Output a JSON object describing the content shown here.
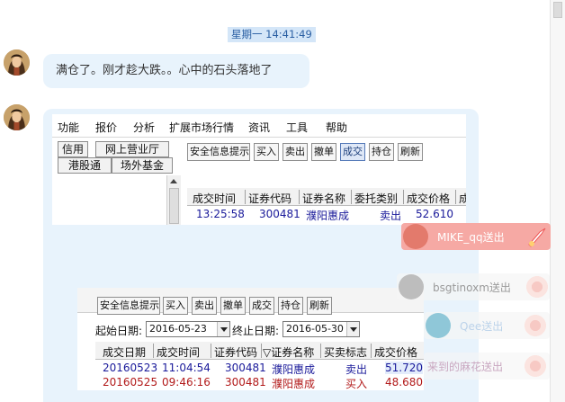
{
  "timestamp": "星期一 14:41:49",
  "messages": {
    "first_text": "满仓了。刚才趁大跌。。心中的石头落地了"
  },
  "shot1": {
    "menu": [
      "功能",
      "报价",
      "分析",
      "扩展市场行情",
      "资讯",
      "工具",
      "帮助"
    ],
    "tabs": [
      "信用",
      "网上营业厅",
      "港股通",
      "场外基金"
    ],
    "toolbar": [
      "安全信息提示",
      "买入",
      "卖出",
      "撤单",
      "成交",
      "持仓",
      "刷新"
    ],
    "active_toolbar": "成交",
    "columns": [
      "成交时间",
      "证券代码",
      "证券名称",
      "委托类别",
      "成交价格",
      "成"
    ],
    "rows": [
      {
        "time": "13:25:58",
        "code": "300481",
        "name": "濮阳惠成",
        "type": "卖出",
        "price": "52.610"
      }
    ]
  },
  "shot2": {
    "toolbar": [
      "安全信息提示",
      "买入",
      "卖出",
      "撤单",
      "成交",
      "持仓",
      "刷新"
    ],
    "start_label": "起始日期:",
    "start_date": "2016-05-23",
    "end_label": "终止日期:",
    "end_date": "2016-05-30",
    "columns": [
      "成交日期",
      "成交时间",
      "证券代码",
      "▽证券名称",
      "买卖标志",
      "成交价格"
    ],
    "rows": [
      {
        "date": "20160523",
        "time": "11:04:54",
        "code": "300481",
        "name": "濮阳惠成",
        "flag": "卖出",
        "price": "51.720",
        "color": "#1a1a9a"
      },
      {
        "date": "20160525",
        "time": "09:46:16",
        "code": "300481",
        "name": "濮阳惠成",
        "flag": "买入",
        "price": "48.680",
        "color": "#b21a1a"
      }
    ]
  },
  "notices": [
    {
      "text": "MIKE_qq送出",
      "color": "#ffffff"
    },
    {
      "text": "bsgtinoxm送出",
      "color": "#9a9a9a"
    },
    {
      "text": "Qee送出",
      "color": "#bcd3ea"
    },
    {
      "text": "来到的麻花送出",
      "color": "#c9a7c0"
    }
  ],
  "colors": {
    "bubble": "#e8f3fc",
    "timestamp_bg": "#d4e6f8",
    "notice_red": "#f6a9a4"
  }
}
